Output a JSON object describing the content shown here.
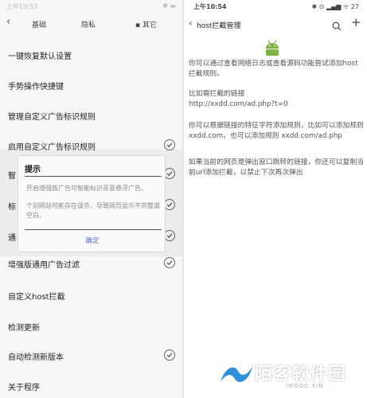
{
  "left": {
    "status_time": "上午10:53",
    "status_icons": "✱ ▬",
    "tabs": [
      "基础",
      "隐私",
      "其它"
    ],
    "menu": [
      {
        "label": "一键恢复默认设置",
        "checked": false
      },
      {
        "label": "手势操作快捷键",
        "checked": false
      },
      {
        "label": "管理自定义广告标识规则",
        "checked": false
      },
      {
        "label": "启用自定义广告标识规则",
        "checked": true
      },
      {
        "label": "智",
        "checked": true
      },
      {
        "label": "标",
        "checked": true
      },
      {
        "label": "通",
        "checked": true
      },
      {
        "label": "增强版通用广告过滤",
        "checked": true
      },
      {
        "label": "自定义host拦截",
        "checked": false
      },
      {
        "label": "检测更新",
        "checked": false
      },
      {
        "label": "自动检测新版本",
        "checked": true
      },
      {
        "label": "关于程序",
        "checked": false
      }
    ],
    "dialog": {
      "title": "提示",
      "line1": "开启增强版广告可智能标识恶意悬浮广告。",
      "line2": "个别网站可能存在误杀，导致网页显示不完整或空白。",
      "ok": "确定"
    }
  },
  "right": {
    "status_time": "上午10:54",
    "status_icons": "✱ ⊙ ▂▄▆ ᯤ 27",
    "title": "host拦截管理",
    "paragraphs": [
      "你可以通过查看网络日志或查看源码功能尝试添加host拦截规则。",
      "比如需拦截的链接",
      "http://xxdd.com/ad.php?t=0",
      "你可以根据链接的特征字符添加规则，比如可以添加规则xxdd.com，也可以添加规则 xxdd.com/ad.php",
      "如果当前的网页是弹出窗口跳转的链接，你还可以复制当前url添加拦截，以禁止下次再次弹出"
    ]
  },
  "watermark": {
    "text": "陌客软件园",
    "sub": "IMOOC.XIN"
  }
}
